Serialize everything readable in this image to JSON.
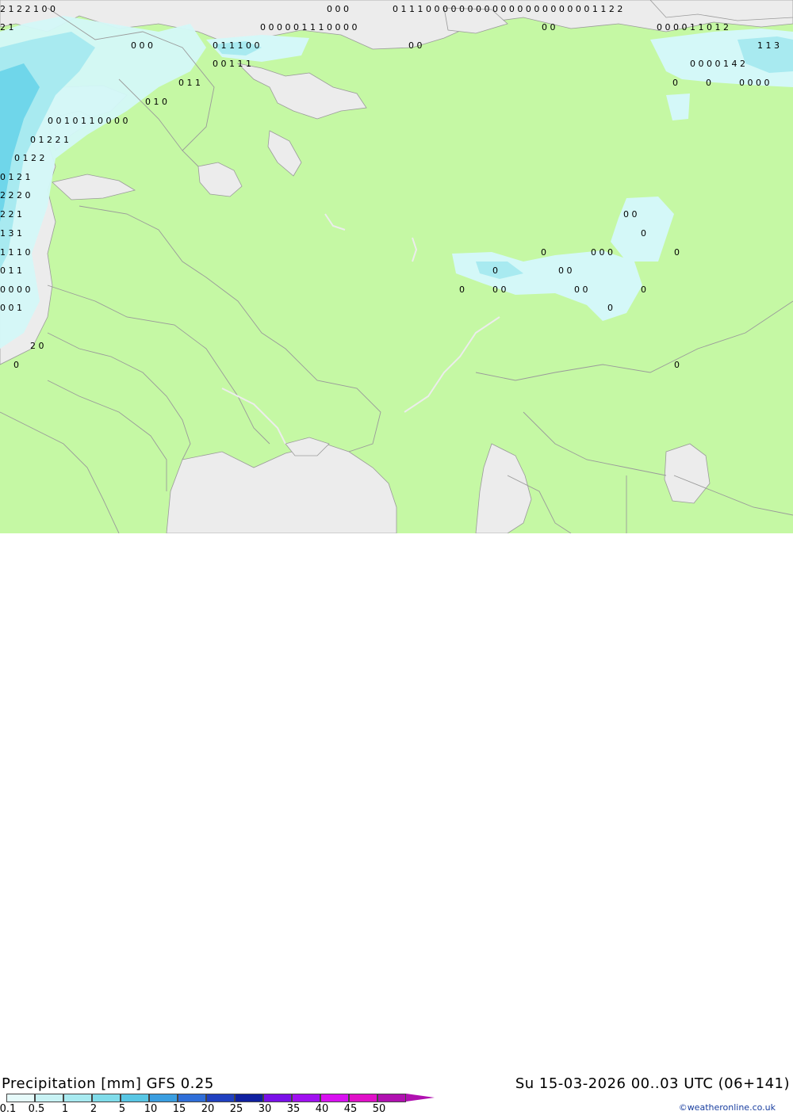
{
  "header": {
    "title": "Precipitation [mm]  GFS 0.25",
    "datetime": "Su 15-03-2026 00..03 UTC (06+141)",
    "credit": "©weatheronline.co.uk"
  },
  "colors": {
    "land": "#c5f8a4",
    "sea": "#ececec",
    "border": "#a8a8a8",
    "precip_light": "#d4f8f8",
    "precip_mid": "#a8eaf0",
    "precip_strong": "#6fd6ea"
  },
  "legend": {
    "labels": [
      "0.1",
      "0.5",
      "1",
      "2",
      "5",
      "10",
      "15",
      "20",
      "25",
      "30",
      "35",
      "40",
      "45",
      "50"
    ],
    "colors": [
      "#e6fafa",
      "#c8f2f4",
      "#a8eaf0",
      "#80dcea",
      "#58c6e4",
      "#3a9ee0",
      "#2f6ed8",
      "#2040c0",
      "#1020a0",
      "#7a10e8",
      "#a010f0",
      "#d810f0",
      "#e010c8",
      "#b010b0"
    ]
  },
  "map_values": [
    {
      "t": "2 1 2 2 1 0 0"
    },
    {
      "t": "2 1"
    },
    {
      "t": "0 0 0"
    },
    {
      "t": "0 1 1 1 0 0"
    },
    {
      "t": "0 0 1 1 1"
    },
    {
      "t": "0 1 1"
    },
    {
      "t": "0 1 0"
    },
    {
      "t": "0 0 1 0 1 1 0 0 0 0"
    },
    {
      "t": "0 1 2 2 1"
    },
    {
      "t": "0 1 2 2"
    },
    {
      "t": "0 1 2 1"
    },
    {
      "t": "2 2 2 0"
    },
    {
      "t": "2 2 1"
    },
    {
      "t": "1 3 1"
    },
    {
      "t": "1 1 1 0"
    },
    {
      "t": "0 1 1"
    },
    {
      "t": "0 0 0 0"
    },
    {
      "t": "0 0 1"
    },
    {
      "t": "2 0"
    },
    {
      "t": "0"
    },
    {
      "t": "0 0 0"
    },
    {
      "t": "0 1 1 1 0 0 0 0 0 0 0 0 0 0 0 0 0 0 0 0 0 0 0 0 1 1 2 2"
    },
    {
      "t": "0 0 0 0 0 1 1 1 0 0 0 0"
    },
    {
      "t": "0 0"
    },
    {
      "t": "0 0"
    },
    {
      "t": "0 0 0 0 1 1 0 1 2"
    },
    {
      "t": "1 1 3"
    },
    {
      "t": "0 0 0 0 1 4 2"
    },
    {
      "t": "0"
    },
    {
      "t": "0"
    },
    {
      "t": "0 0 0 0"
    },
    {
      "t": "0 0"
    },
    {
      "t": "0"
    },
    {
      "t": "0"
    },
    {
      "t": "0 0 0"
    },
    {
      "t": "0"
    },
    {
      "t": "0"
    },
    {
      "t": "0 0"
    },
    {
      "t": "0"
    },
    {
      "t": "0 0"
    },
    {
      "t": "0 0"
    },
    {
      "t": "0"
    },
    {
      "t": "0"
    },
    {
      "t": "0"
    }
  ]
}
